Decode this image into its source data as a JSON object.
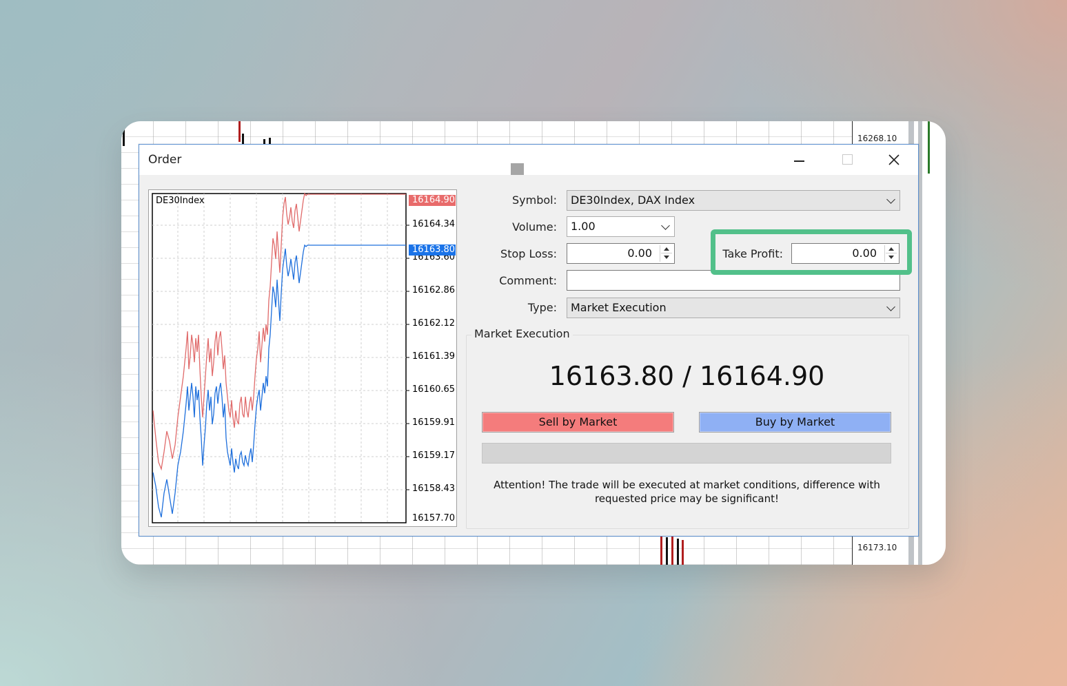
{
  "background_chart": {
    "price_top": "16268.10",
    "price_bottom": "16173.10"
  },
  "window": {
    "title": "Order",
    "buttons": {
      "minimize": "minimize-icon",
      "maximize": "maximize-icon",
      "close": "close-icon"
    }
  },
  "mini_chart": {
    "symbol": "DE30Index",
    "ask_tag": "16164.90",
    "bid_tag": "16163.80",
    "ask_color": "#e86b6b",
    "bid_color": "#1a73e8",
    "ticks": [
      "16164.34",
      "16163.60",
      "16162.86",
      "16162.12",
      "16161.39",
      "16160.65",
      "16159.91",
      "16159.17",
      "16158.43",
      "16157.70"
    ]
  },
  "form": {
    "symbol_label": "Symbol:",
    "symbol_value": "DE30Index, DAX Index",
    "volume_label": "Volume:",
    "volume_value": "1.00",
    "stop_loss_label": "Stop Loss:",
    "stop_loss_value": "0.00",
    "take_profit_label": "Take Profit:",
    "take_profit_value": "0.00",
    "comment_label": "Comment:",
    "comment_value": "",
    "type_label": "Type:",
    "type_value": "Market Execution"
  },
  "execution": {
    "group_title": "Market Execution",
    "bid_ask": "16163.80 / 16164.90",
    "sell_label": "Sell by Market",
    "buy_label": "Buy by Market",
    "attention_line1": "Attention! The trade will be executed at market conditions, difference with",
    "attention_line2": "requested price may be significant!"
  },
  "highlight_color": "#52c08a"
}
